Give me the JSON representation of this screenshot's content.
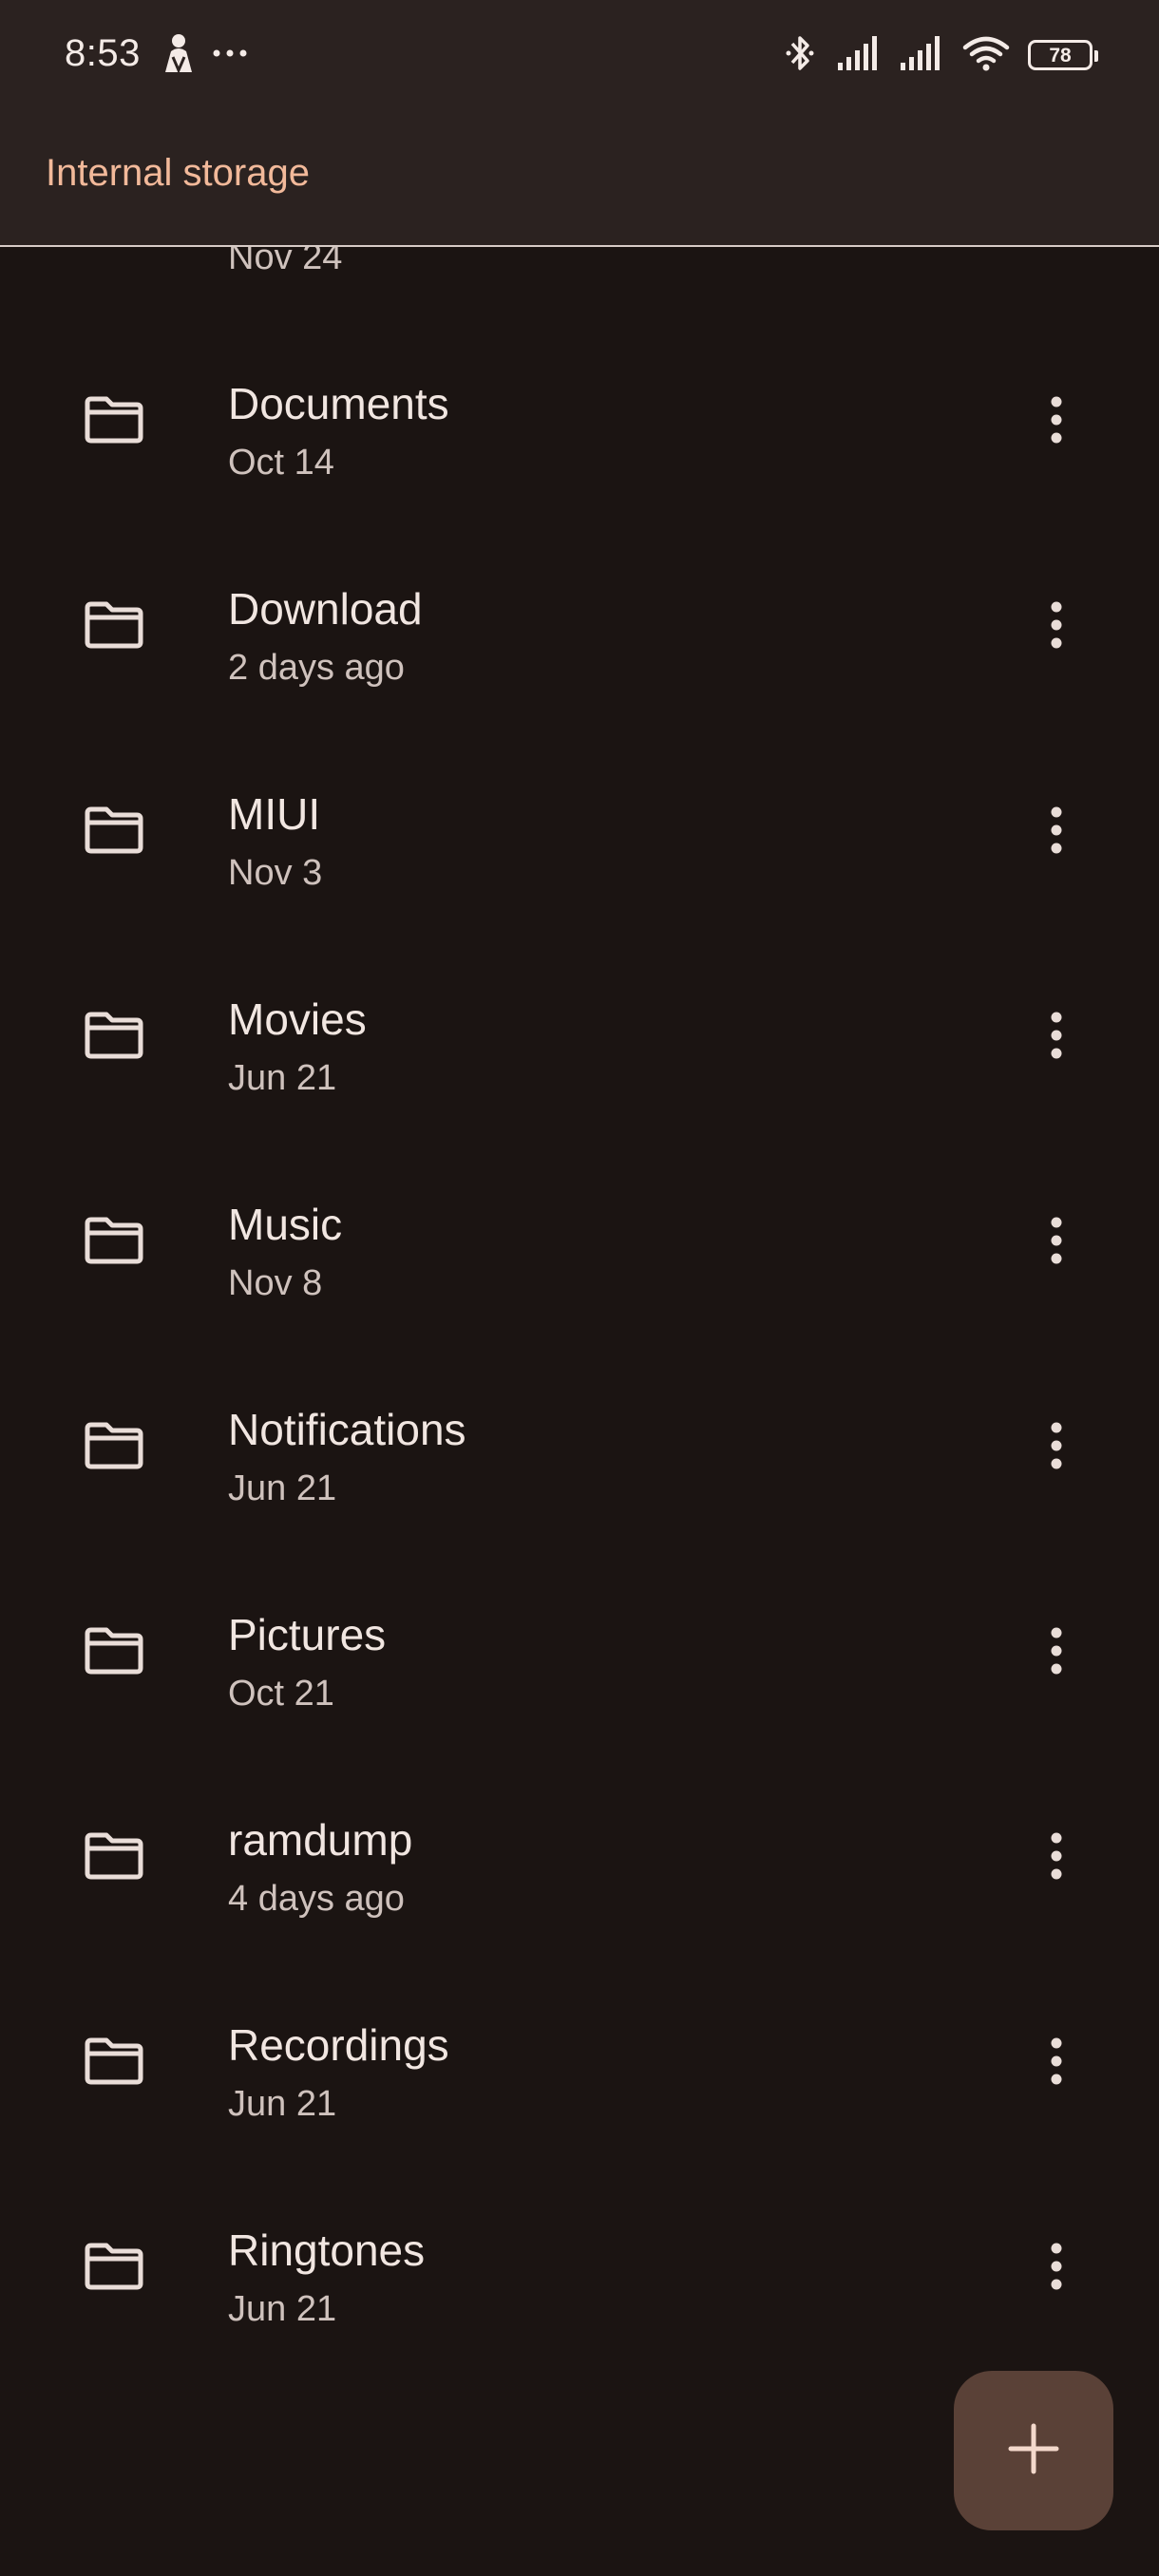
{
  "status_bar": {
    "time": "8:53",
    "left_icons": [
      "person-silhouette-icon",
      "more-horiz-icon"
    ],
    "right_icons": [
      "bluetooth-icon",
      "cellular-signal-icon",
      "cellular-signal-icon",
      "wifi-icon"
    ],
    "battery_level": "78"
  },
  "app_bar": {
    "title": "Internal storage"
  },
  "folders": [
    {
      "name": "",
      "date": "Nov 24"
    },
    {
      "name": "Documents",
      "date": "Oct 14"
    },
    {
      "name": "Download",
      "date": "2 days ago"
    },
    {
      "name": "MIUI",
      "date": "Nov 3"
    },
    {
      "name": "Movies",
      "date": "Jun 21"
    },
    {
      "name": "Music",
      "date": "Nov 8"
    },
    {
      "name": "Notifications",
      "date": "Jun 21"
    },
    {
      "name": "Pictures",
      "date": "Oct 21"
    },
    {
      "name": "ramdump",
      "date": "4 days ago"
    },
    {
      "name": "Recordings",
      "date": "Jun 21"
    },
    {
      "name": "Ringtones",
      "date": "Jun 21"
    }
  ],
  "fab": {
    "icon": "plus-icon"
  },
  "colors": {
    "background": "#1b1412",
    "app_bar": "#2b2220",
    "accent_title": "#f2b99a",
    "fab": "#5a4137"
  }
}
